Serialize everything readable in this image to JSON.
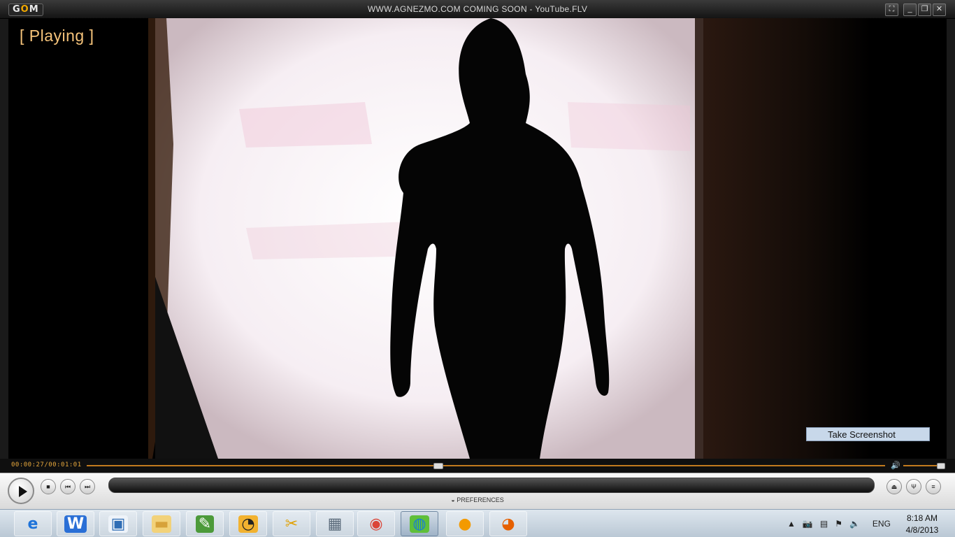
{
  "window": {
    "logo": "GOM",
    "title": "WWW.AGNEZMO.COM COMING SOON - YouTube.FLV"
  },
  "video": {
    "status_text": "[ Playing ]",
    "screenshot_button": "Take Screenshot"
  },
  "seek": {
    "time": "00:00:27/00:01:01",
    "position_fraction": 0.44,
    "volume_fraction": 0.95
  },
  "controls": {
    "preferences_label": "PREFERENCES"
  },
  "taskbar": {
    "apps": [
      {
        "name": "internet-explorer-icon",
        "glyph": "e",
        "color": "#1e73d9"
      },
      {
        "name": "word-app-icon",
        "glyph": "W",
        "color": "#ffffff",
        "bg": "#2a6fd6"
      },
      {
        "name": "store-app-icon",
        "glyph": "▣",
        "color": "#2f6db5",
        "bg": "#eef3f9"
      },
      {
        "name": "file-explorer-icon",
        "glyph": "▬",
        "color": "#d7a23a",
        "bg": "#f2d27a"
      },
      {
        "name": "evernote-icon",
        "glyph": "✎",
        "color": "#ffffff",
        "bg": "#4c9a3a"
      },
      {
        "name": "speedometer-icon",
        "glyph": "◔",
        "color": "#222",
        "bg": "#f2b230"
      },
      {
        "name": "tools-icon",
        "glyph": "✂",
        "color": "#e1a000"
      },
      {
        "name": "monitor-app-icon",
        "glyph": "▦",
        "color": "#5a6a7a"
      },
      {
        "name": "chrome-icon",
        "glyph": "◉",
        "color": "#db4437"
      },
      {
        "name": "download-manager-icon",
        "glyph": "◍",
        "color": "#1b7fcf",
        "bg": "#5fbf3a"
      },
      {
        "name": "gom-player-icon",
        "glyph": "●",
        "color": "#f39a00"
      },
      {
        "name": "firefox-icon",
        "glyph": "◕",
        "color": "#e66000"
      }
    ],
    "language": "ENG",
    "time": "8:18 AM",
    "date": "4/8/2013"
  }
}
